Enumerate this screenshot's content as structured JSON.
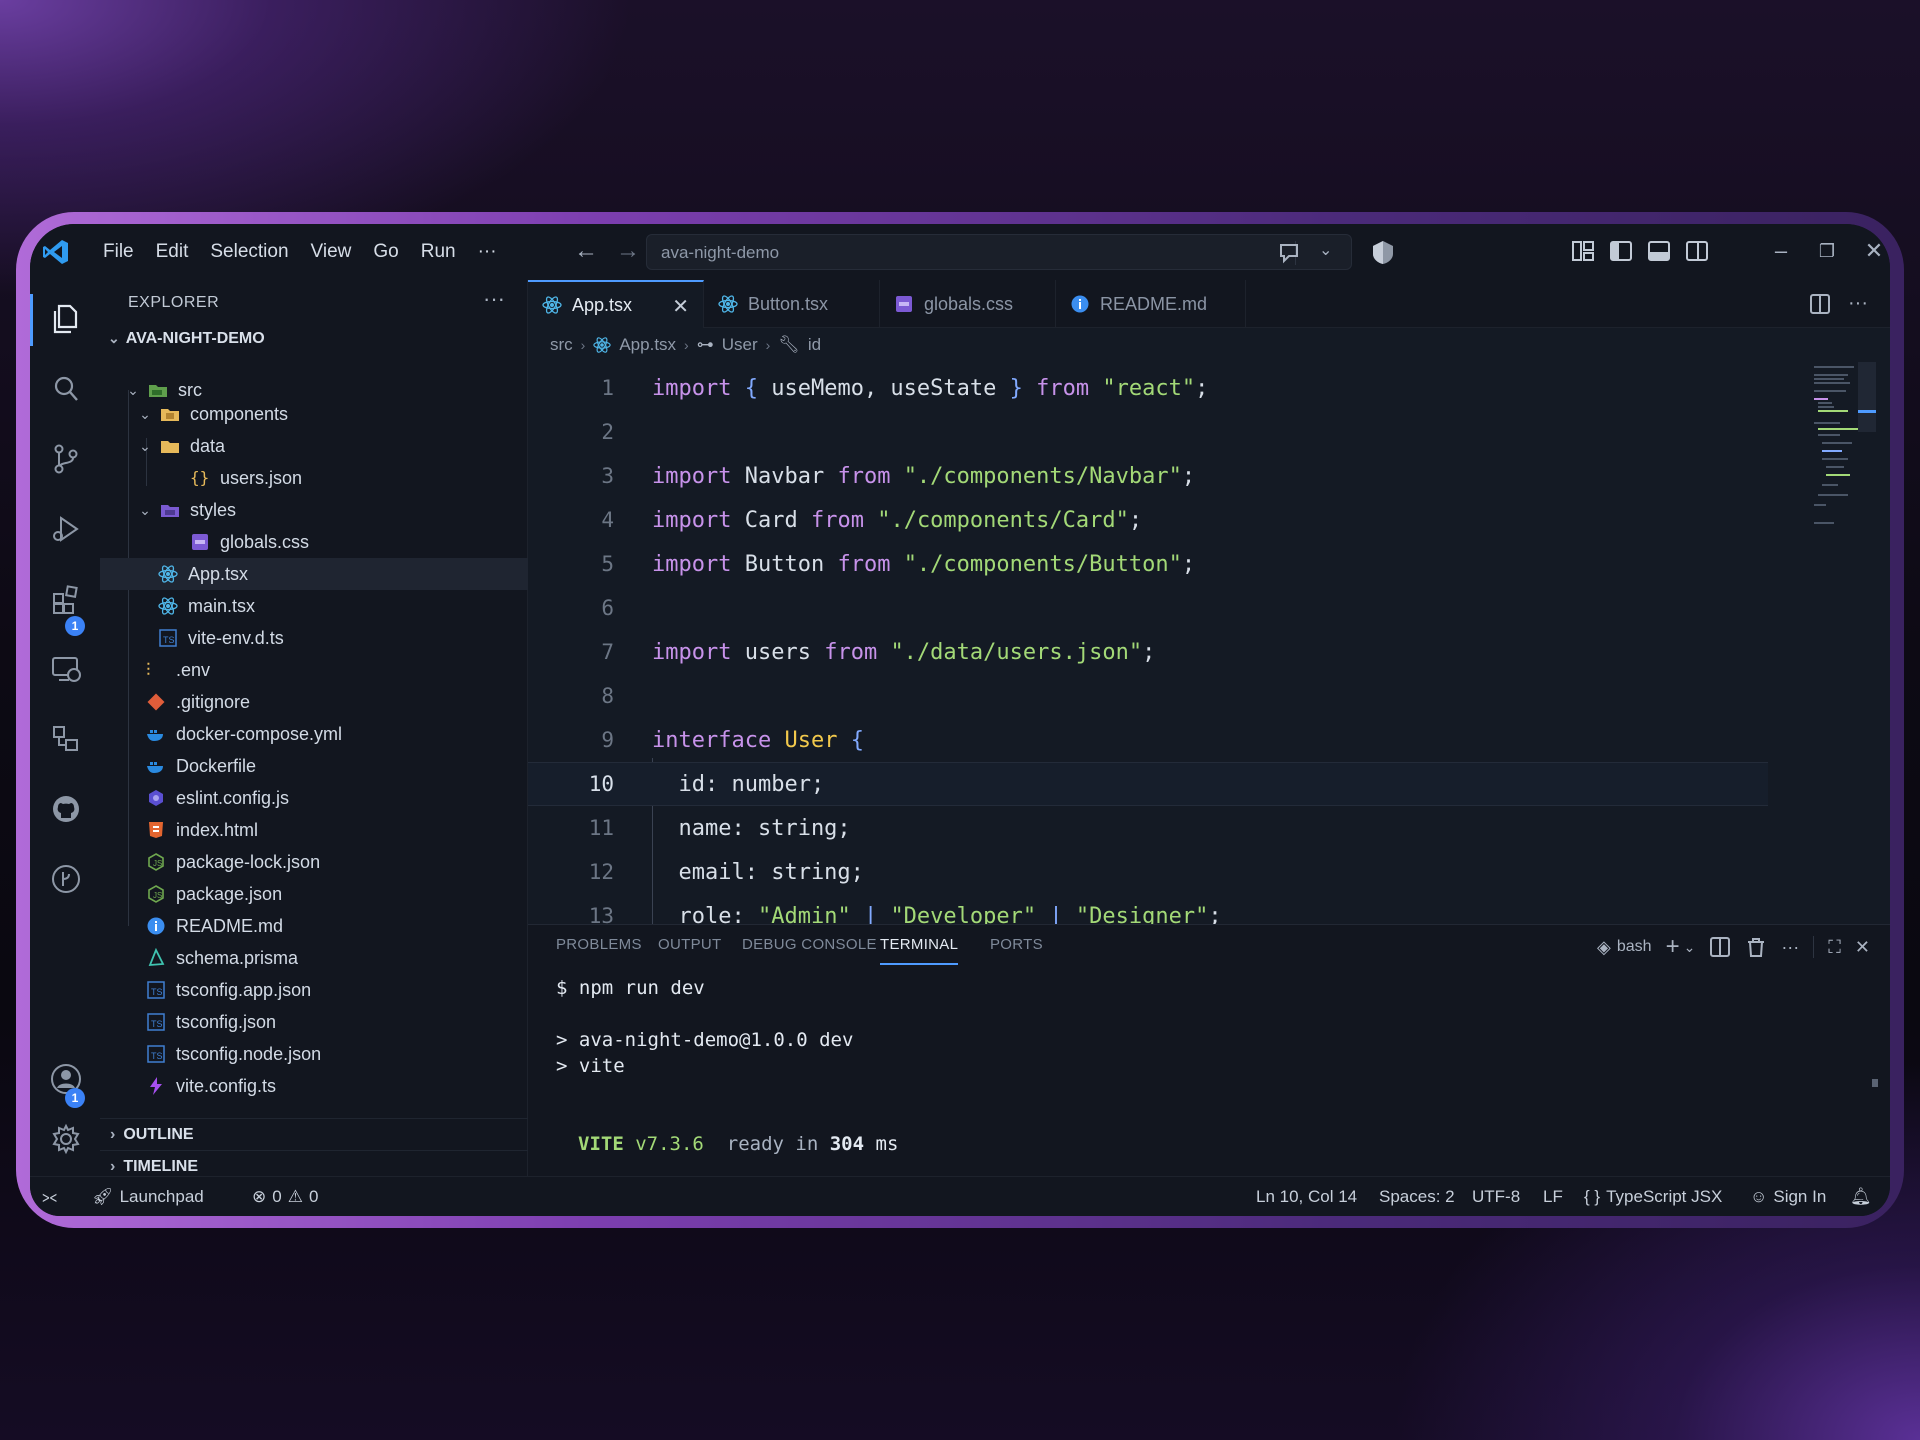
{
  "titlebar": {
    "menu": [
      "File",
      "Edit",
      "Selection",
      "View",
      "Go",
      "Run",
      "···"
    ],
    "command_center": "ava-night-demo"
  },
  "activitybar": {
    "extensions_badge": "1",
    "accounts_badge": "1"
  },
  "sidebar": {
    "header": "EXPLORER",
    "more": "···",
    "root": "AVA-NIGHT-DEMO",
    "tree": [
      {
        "label": "src",
        "icon": "folder-src-icon",
        "chev": "v"
      },
      {
        "label": "components",
        "icon": "folder-components-icon",
        "chev": "v"
      },
      {
        "label": "data",
        "icon": "folder-icon",
        "chev": "v"
      },
      {
        "label": "users.json",
        "icon": "json-icon"
      },
      {
        "label": "styles",
        "icon": "folder-css-icon",
        "chev": "v"
      },
      {
        "label": "globals.css",
        "icon": "css-icon"
      },
      {
        "label": "App.tsx",
        "icon": "react-icon"
      },
      {
        "label": "main.tsx",
        "icon": "react-icon"
      },
      {
        "label": "vite-env.d.ts",
        "icon": "ts-icon"
      },
      {
        "label": ".env",
        "icon": "env-icon"
      },
      {
        "label": ".gitignore",
        "icon": "git-icon"
      },
      {
        "label": "docker-compose.yml",
        "icon": "docker-icon"
      },
      {
        "label": "Dockerfile",
        "icon": "docker-icon"
      },
      {
        "label": "eslint.config.js",
        "icon": "eslint-icon"
      },
      {
        "label": "index.html",
        "icon": "html-icon"
      },
      {
        "label": "package-lock.json",
        "icon": "npm-icon"
      },
      {
        "label": "package.json",
        "icon": "npm-icon"
      },
      {
        "label": "README.md",
        "icon": "info-icon"
      },
      {
        "label": "schema.prisma",
        "icon": "prisma-icon"
      },
      {
        "label": "tsconfig.app.json",
        "icon": "tsconfig-icon"
      },
      {
        "label": "tsconfig.json",
        "icon": "tsconfig-icon"
      },
      {
        "label": "tsconfig.node.json",
        "icon": "tsconfig-icon"
      },
      {
        "label": "vite.config.ts",
        "icon": "vite-icon"
      }
    ],
    "outline": "OUTLINE",
    "timeline": "TIMELINE"
  },
  "tabs": [
    {
      "label": "App.tsx",
      "active": true,
      "close": "✕"
    },
    {
      "label": "Button.tsx"
    },
    {
      "label": "globals.css"
    },
    {
      "label": "README.md"
    }
  ],
  "breadcrumb": [
    "src",
    "App.tsx",
    "User",
    "id"
  ],
  "editor": {
    "lines": [
      {
        "n": "1",
        "code": "import { useMemo, useState } from \"react\";"
      },
      {
        "n": "2",
        "code": ""
      },
      {
        "n": "3",
        "code": "import Navbar from \"./components/Navbar\";"
      },
      {
        "n": "4",
        "code": "import Card from \"./components/Card\";"
      },
      {
        "n": "5",
        "code": "import Button from \"./components/Button\";"
      },
      {
        "n": "6",
        "code": ""
      },
      {
        "n": "7",
        "code": "import users from \"./data/users.json\";"
      },
      {
        "n": "8",
        "code": ""
      },
      {
        "n": "9",
        "code": "interface User {"
      },
      {
        "n": "10",
        "code": "  id: number;"
      },
      {
        "n": "11",
        "code": "  name: string;"
      },
      {
        "n": "12",
        "code": "  email: string;"
      },
      {
        "n": "13",
        "code": "  role: \"Admin\" | \"Developer\" | \"Designer\";"
      }
    ],
    "current_line": "10"
  },
  "panel": {
    "tabs": [
      "PROBLEMS",
      "OUTPUT",
      "DEBUG CONSOLE",
      "TERMINAL",
      "PORTS"
    ],
    "active_tab": "TERMINAL",
    "shell": "bash",
    "terminal": {
      "cmd": "$ npm run dev",
      "out1": "> ava-night-demo@1.0.0 dev",
      "out2": "> vite",
      "vite_name": "VITE",
      "vite_ver": "v7.3.6",
      "ready": "ready in",
      "ms_num": "304",
      "ms_unit": "ms"
    }
  },
  "statusbar": {
    "launchpad": "Launchpad",
    "errors": "0",
    "warnings": "0",
    "position": "Ln 10, Col 14",
    "spaces": "Spaces: 2",
    "encoding": "UTF-8",
    "eol": "LF",
    "language": "TypeScript JSX",
    "sign_in": "Sign In"
  },
  "colors": {
    "accent": "#4e9bff",
    "keyword": "#c792ea",
    "string": "#a3d977",
    "type": "#f2c94c",
    "background": "#12161f"
  }
}
